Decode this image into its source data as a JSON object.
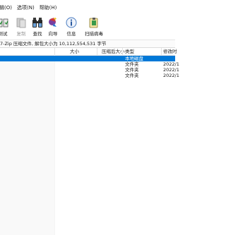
{
  "menu": [
    "...(O)",
    "选项(N)",
    "帮助(H)"
  ],
  "menu_visible": [
    "辑(O)",
    "选项(N)",
    "帮助(H)"
  ],
  "toolbar": {
    "buttons": [
      {
        "label": "测试",
        "icon": "test-icon",
        "disabled": false
      },
      {
        "label": "复制",
        "icon": "copy-icon",
        "disabled": true
      },
      {
        "label": "查找",
        "icon": "find-icon",
        "disabled": false
      },
      {
        "label": "向导",
        "icon": "wizard-icon",
        "disabled": false
      },
      {
        "label": "信息",
        "icon": "info-icon",
        "disabled": false
      },
      {
        "label": "扫描病毒",
        "icon": "scan-virus-icon",
        "disabled": false
      }
    ]
  },
  "infobar": {
    "text": "7-Zip 压缩文件, 解包大小为 10,112,554,531 字节"
  },
  "columns": {
    "size": "大小",
    "packed_size": "压缩后大小",
    "type": "类型",
    "modified": "修改时"
  },
  "rows": [
    {
      "type": "本地磁盘",
      "modified": "",
      "selected": true
    },
    {
      "type": "文件夹",
      "modified": "2022/1",
      "selected": false
    },
    {
      "type": "文件夹",
      "modified": "2022/1",
      "selected": false
    },
    {
      "type": "文件夹",
      "modified": "2022/1",
      "selected": false
    }
  ],
  "colors": {
    "selection": "#0078d7"
  }
}
